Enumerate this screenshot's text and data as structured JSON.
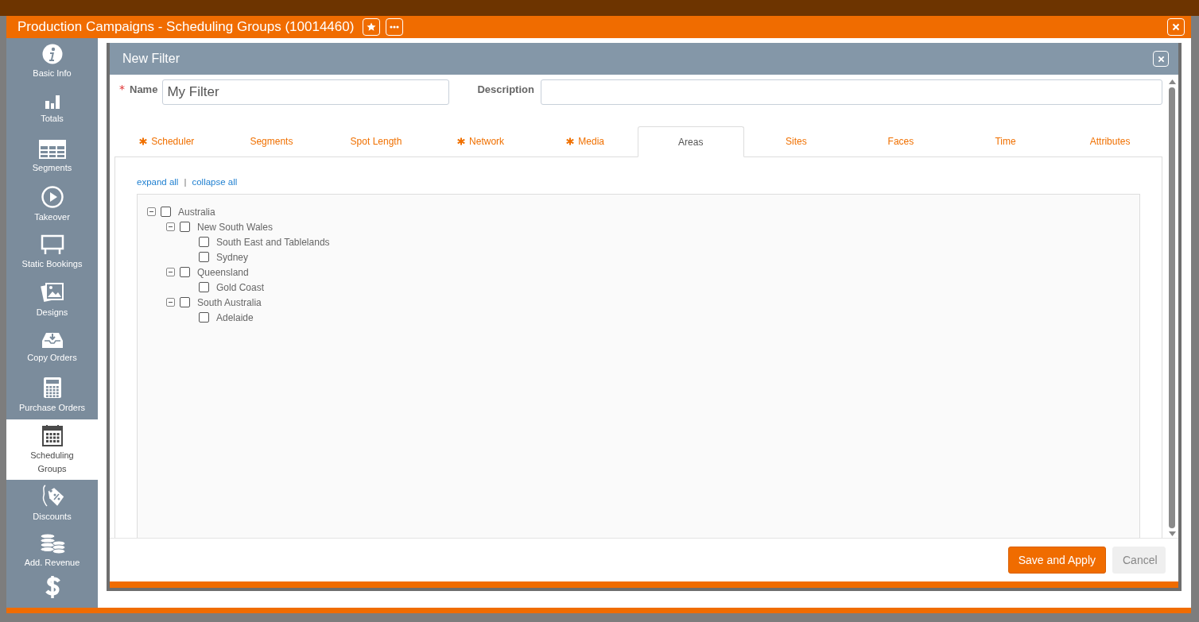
{
  "window": {
    "title": "Production Campaigns - Scheduling Groups (10014460)"
  },
  "sidebar": {
    "items": [
      {
        "label": "Basic Info",
        "selected": false
      },
      {
        "label": "Totals",
        "selected": false
      },
      {
        "label": "Segments",
        "selected": false
      },
      {
        "label": "Takeover",
        "selected": false
      },
      {
        "label": "Static Bookings",
        "selected": false
      },
      {
        "label": "Designs",
        "selected": false
      },
      {
        "label": "Copy Orders",
        "selected": false
      },
      {
        "label": "Purchase Orders",
        "selected": false
      },
      {
        "label": "Scheduling Groups",
        "selected": true
      },
      {
        "label": "Discounts",
        "selected": false
      },
      {
        "label": "Add. Revenue",
        "selected": false
      }
    ]
  },
  "dialog": {
    "title": "New Filter",
    "name_field": {
      "required_mark": "*",
      "label": "Name",
      "value": "My Filter"
    },
    "description_field": {
      "label": "Description"
    },
    "tabs": [
      {
        "label": "Scheduler",
        "required": true,
        "selected": false
      },
      {
        "label": "Segments",
        "required": false,
        "selected": false
      },
      {
        "label": "Spot Length",
        "required": false,
        "selected": false
      },
      {
        "label": "Network",
        "required": true,
        "selected": false
      },
      {
        "label": "Media",
        "required": true,
        "selected": false
      },
      {
        "label": "Areas",
        "required": false,
        "selected": true
      },
      {
        "label": "Sites",
        "required": false,
        "selected": false
      },
      {
        "label": "Faces",
        "required": false,
        "selected": false
      },
      {
        "label": "Time",
        "required": false,
        "selected": false
      },
      {
        "label": "Attributes",
        "required": false,
        "selected": false
      }
    ],
    "links": [
      "expand all",
      "collapse all"
    ],
    "link_separator": "|",
    "tree": [
      {
        "label": "Australia",
        "checked": false,
        "expanded": true,
        "children": [
          {
            "label": "New South Wales",
            "checked": false,
            "expanded": true,
            "children": [
              {
                "label": "South East and Tablelands",
                "checked": false
              },
              {
                "label": "Sydney",
                "checked": false
              }
            ]
          },
          {
            "label": "Queensland",
            "checked": false,
            "expanded": true,
            "children": [
              {
                "label": "Gold Coast",
                "checked": false
              }
            ]
          },
          {
            "label": "South Australia",
            "checked": false,
            "expanded": true,
            "children": [
              {
                "label": "Adelaide",
                "checked": false
              }
            ]
          }
        ]
      }
    ],
    "buttons": [
      {
        "label": "Save and Apply",
        "kind": "primary"
      },
      {
        "label": "Cancel",
        "kind": "secondary"
      }
    ]
  }
}
